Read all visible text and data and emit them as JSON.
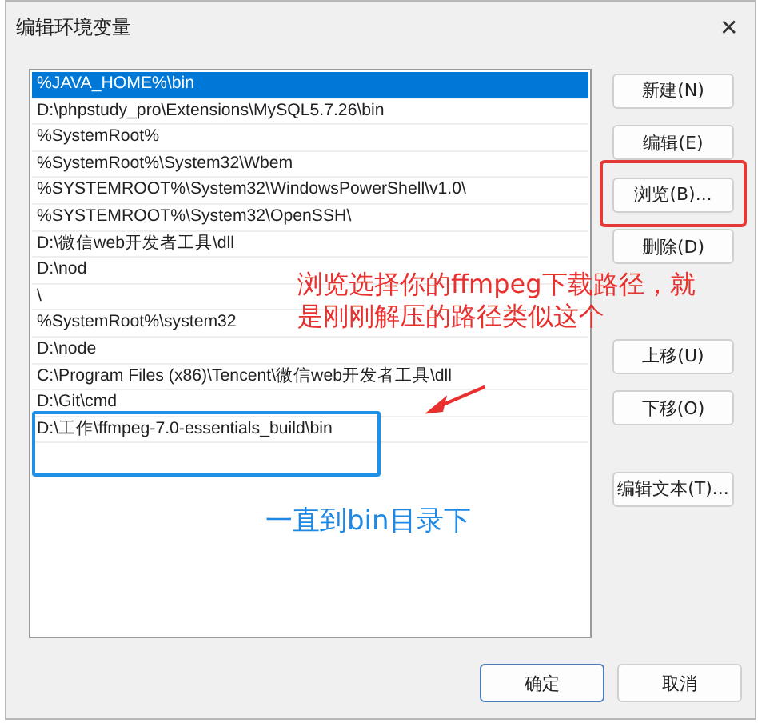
{
  "window": {
    "title": "编辑环境变量",
    "close": "✕"
  },
  "paths": [
    {
      "text": "%JAVA_HOME%\\bin",
      "selected": true,
      "highlighted": false
    },
    {
      "text": "D:\\phpstudy_pro\\Extensions\\MySQL5.7.26\\bin",
      "selected": false,
      "highlighted": false
    },
    {
      "text": "%SystemRoot%",
      "selected": false,
      "highlighted": false
    },
    {
      "text": "%SystemRoot%\\System32\\Wbem",
      "selected": false,
      "highlighted": false
    },
    {
      "text": "%SYSTEMROOT%\\System32\\WindowsPowerShell\\v1.0\\",
      "selected": false,
      "highlighted": false
    },
    {
      "text": "%SYSTEMROOT%\\System32\\OpenSSH\\",
      "selected": false,
      "highlighted": false
    },
    {
      "text": "D:\\微信web开发者工具\\dll",
      "selected": false,
      "highlighted": false
    },
    {
      "text": "D:\\nod",
      "selected": false,
      "highlighted": false
    },
    {
      "text": "\\",
      "selected": false,
      "highlighted": false
    },
    {
      "text": "%SystemRoot%\\system32",
      "selected": false,
      "highlighted": false
    },
    {
      "text": "D:\\node",
      "selected": false,
      "highlighted": false
    },
    {
      "text": "C:\\Program Files (x86)\\Tencent\\微信web开发者工具\\dll",
      "selected": false,
      "highlighted": false
    },
    {
      "text": "D:\\Git\\cmd",
      "selected": false,
      "highlighted": false
    },
    {
      "text": "D:\\工作\\ffmpeg-7.0-essentials_build\\bin",
      "selected": false,
      "highlighted": true
    }
  ],
  "side_button_groups": [
    {
      "buttons": [
        {
          "label": "新建(N)",
          "highlighted": false
        },
        {
          "label": "编辑(E)",
          "highlighted": false
        },
        {
          "label": "浏览(B)...",
          "highlighted": true
        },
        {
          "label": "删除(D)",
          "highlighted": false
        }
      ]
    },
    {
      "buttons": [
        {
          "label": "上移(U)",
          "highlighted": false
        },
        {
          "label": "下移(O)",
          "highlighted": false
        }
      ]
    },
    {
      "buttons": [
        {
          "label": "编辑文本(T)...",
          "highlighted": false
        }
      ]
    }
  ],
  "footer_buttons": [
    {
      "label": "确定",
      "default": true
    },
    {
      "label": "取消",
      "default": false
    }
  ],
  "annotations": [
    {
      "kind": "red",
      "text": "浏览选择你的ffmpeg下载路径，就是刚刚解压的路径类似这个"
    },
    {
      "kind": "blue",
      "text": "一直到bin目录下"
    }
  ]
}
